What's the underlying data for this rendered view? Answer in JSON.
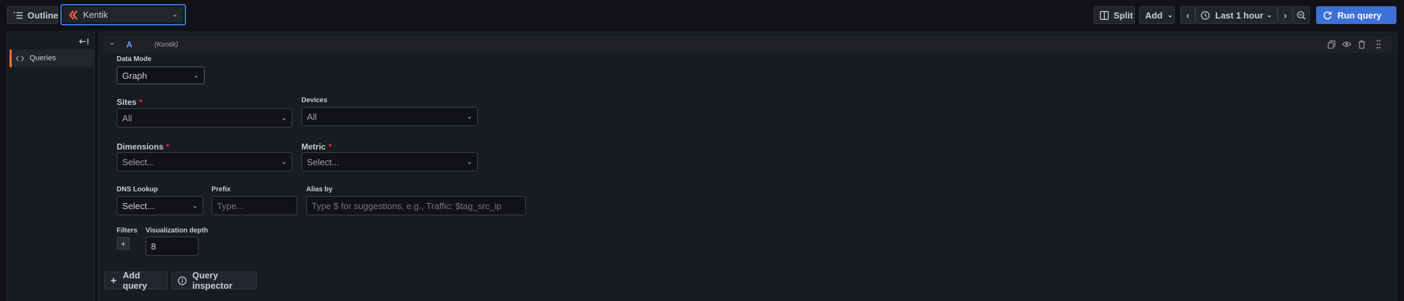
{
  "toolbar": {
    "outline_label": "Outline",
    "datasource_label": "Kentik",
    "split_label": "Split",
    "add_label": "Add",
    "time_range_label": "Last 1 hour",
    "run_query_label": "Run query"
  },
  "sidebar": {
    "items": [
      {
        "label": "Queries"
      }
    ]
  },
  "query": {
    "ref_id": "A",
    "datasource_name": "(Kentik)",
    "data_mode": {
      "label": "Data Mode",
      "value": "Graph"
    },
    "sites": {
      "label": "Sites",
      "value": "All"
    },
    "devices": {
      "label": "Devices",
      "value": "All"
    },
    "dimensions": {
      "label": "Dimensions",
      "placeholder": "Select..."
    },
    "metric": {
      "label": "Metric",
      "placeholder": "Select..."
    },
    "dns_lookup": {
      "label": "DNS Lookup",
      "placeholder": "Select..."
    },
    "prefix": {
      "label": "Prefix",
      "placeholder": "Type..."
    },
    "alias_by": {
      "label": "Alias by",
      "placeholder": "Type $ for suggestions, e.g., Traffic: $tag_src_ip"
    },
    "filters": {
      "label": "Filters"
    },
    "visualization_depth": {
      "label": "Visualization depth",
      "value": "8"
    },
    "required_marker": "*"
  },
  "footer": {
    "add_query_label": "Add query",
    "query_inspector_label": "Query inspector"
  },
  "colors": {
    "accent": "#3d71d9",
    "brand": "#f55f3e",
    "required": "#e02f44",
    "background": "#111217"
  }
}
